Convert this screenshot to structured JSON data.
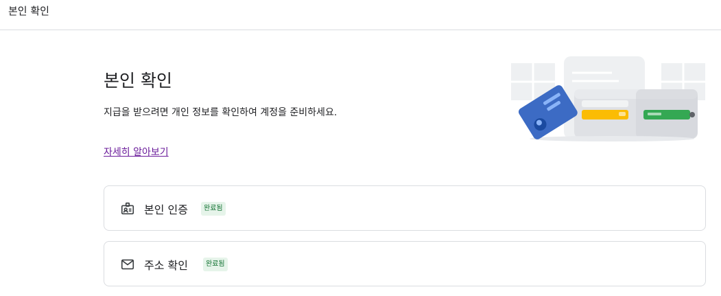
{
  "header": {
    "title": "본인 확인"
  },
  "main": {
    "title": "본인 확인",
    "description": "지급을 받으려면 개인 정보를 확인하여 계정을 준비하세요.",
    "learn_more": "자세히 알아보기"
  },
  "items": [
    {
      "label": "본인 인증",
      "status": "완료됨",
      "icon": "id-badge-icon"
    },
    {
      "label": "주소 확인",
      "status": "완료됨",
      "icon": "envelope-icon"
    }
  ],
  "colors": {
    "accent_link": "#6a1b9a",
    "badge_bg": "#e6f4ea",
    "badge_text": "#137333",
    "card_blue": "#3c6bc4",
    "card_yellow": "#fbbc04",
    "card_green": "#34a853"
  }
}
